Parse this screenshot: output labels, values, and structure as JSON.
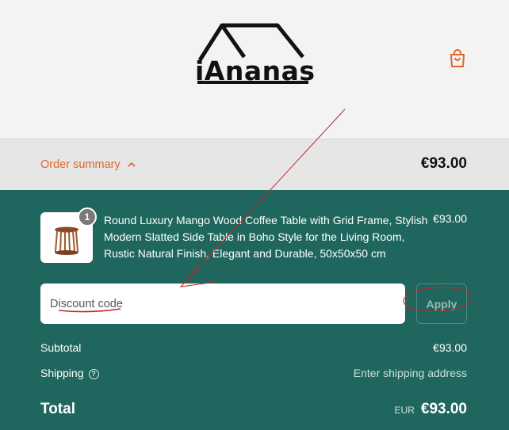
{
  "header": {
    "brand": "iAnanas",
    "cart_icon": "shopping-bag-icon"
  },
  "order_summary": {
    "toggle_label": "Order summary",
    "toggle_icon": "chevron-up-icon",
    "total": "€93.00"
  },
  "line_items": [
    {
      "quantity": "1",
      "title": "Round Luxury Mango Wood Coffee Table with Grid Frame, Stylish Modern Slatted Side Table in Boho Style for the Living Room, Rustic Natural Finish, Elegant and Durable, 50x50x50 cm",
      "price": "€93.00"
    }
  ],
  "discount": {
    "placeholder": "Discount code",
    "apply_label": "Apply"
  },
  "totals": {
    "subtotal_label": "Subtotal",
    "subtotal_value": "€93.00",
    "shipping_label": "Shipping",
    "shipping_value": "Enter shipping address",
    "total_label": "Total",
    "currency": "EUR",
    "total_value": "€93.00"
  },
  "colors": {
    "accent": "#e0652c",
    "panel": "#1f675e",
    "annotation": "#c0282a"
  }
}
